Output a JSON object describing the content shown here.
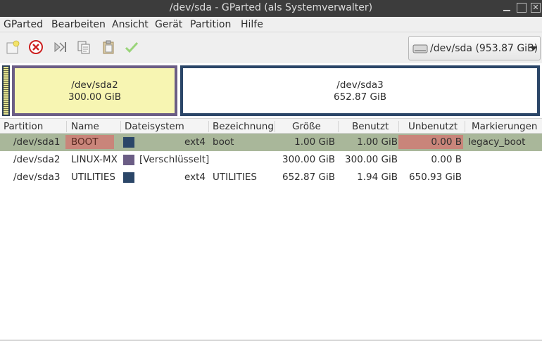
{
  "window": {
    "title": "/dev/sda - GParted (als Systemverwalter)",
    "controls": {
      "minimize_icon": "minimize-icon",
      "maximize_icon": "maximize-icon",
      "close_icon": "close-icon"
    }
  },
  "menu": {
    "items": [
      "GParted",
      "Bearbeiten",
      "Ansicht",
      "Gerät",
      "Partition",
      "Hilfe"
    ]
  },
  "toolbar": {
    "icons": [
      "new-partition-icon",
      "delete-icon",
      "resize-move-icon",
      "copy-icon",
      "paste-icon",
      "apply-icon"
    ]
  },
  "device_selector": {
    "device": "/dev/sda",
    "size": "(953.87 GiB)",
    "icon": "harddisk-icon"
  },
  "graph": {
    "partitions": [
      {
        "name": "/dev/sda2",
        "size": "300.00 GiB",
        "border_color": "#6b5d85",
        "fill_color": "#f7f5b2"
      },
      {
        "name": "/dev/sda3",
        "size": "652.87 GiB",
        "border_color": "#2b4668",
        "fill_color": "#ffffff"
      }
    ]
  },
  "table": {
    "headers": [
      "Partition",
      "Name",
      "Dateisystem",
      "Bezeichnung",
      "Größe",
      "Benutzt",
      "Unbenutzt",
      "Markierungen"
    ],
    "rows": [
      {
        "partition": "/dev/sda1",
        "name": "BOOT",
        "fs_color": "#2b4668",
        "fs": "ext4",
        "label": "boot",
        "size": "1.00 GiB",
        "used": "1.00 GiB",
        "unused": "0.00 B",
        "flags": "legacy_boot",
        "selected": true
      },
      {
        "partition": "/dev/sda2",
        "name": "LINUX-MX",
        "fs_color": "#6b5d85",
        "fs": "[Verschlüsselt]",
        "label": "",
        "size": "300.00 GiB",
        "used": "300.00 GiB",
        "unused": "0.00 B",
        "flags": "",
        "selected": false
      },
      {
        "partition": "/dev/sda3",
        "name": "UTILITIES",
        "fs_color": "#2b4668",
        "fs": "ext4",
        "label": "UTILITIES",
        "size": "652.87 GiB",
        "used": "1.94 GiB",
        "unused": "650.93 GiB",
        "flags": "",
        "selected": false
      }
    ]
  },
  "colors": {
    "selection": "#a9b79a",
    "highlight": "#c9857a",
    "titlebar": "#3c3c3c"
  }
}
